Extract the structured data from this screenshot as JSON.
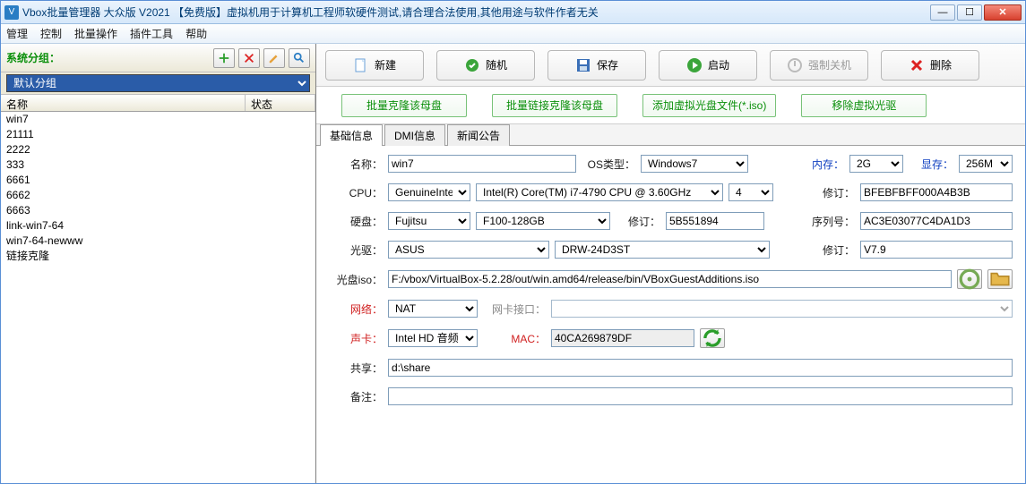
{
  "window": {
    "title": "Vbox批量管理器 大众版 V2021 【免费版】虚拟机用于计算机工程师软硬件测试,请合理合法使用,其他用途与软件作者无关"
  },
  "menu": [
    "管理",
    "控制",
    "批量操作",
    "插件工具",
    "帮助"
  ],
  "left": {
    "group_label": "系统分组：",
    "group_selected": "默认分组",
    "col_name": "名称",
    "col_status": "状态",
    "rows": [
      "win7",
      "21111",
      "2222",
      "333",
      "6661",
      "6662",
      "6663",
      "link-win7-64",
      "win7-64-newww",
      "链接克隆"
    ]
  },
  "toolbar1": {
    "new": "新建",
    "random": "随机",
    "save": "保存",
    "start": "启动",
    "force_off": "强制关机",
    "delete": "删除"
  },
  "toolbar2": {
    "clone": "批量克隆该母盘",
    "link_clone": "批量链接克隆该母盘",
    "add_iso": "添加虚拟光盘文件(*.iso)",
    "remove_iso": "移除虚拟光驱"
  },
  "tabs": [
    "基础信息",
    "DMI信息",
    "新闻公告"
  ],
  "form": {
    "name_lbl": "名称：",
    "name_val": "win7",
    "os_lbl": "OS类型：",
    "os_val": "Windows7",
    "mem_lbl": "内存：",
    "mem_val": "2G",
    "vram_lbl": "显存：",
    "vram_val": "256M",
    "cpu_lbl": "CPU：",
    "cpu_vendor": "GenuineIntel",
    "cpu_model": "Intel(R) Core(TM) i7-4790 CPU @ 3.60GHz",
    "cpu_count": "4",
    "cpu_rev_lbl": "修订：",
    "cpu_rev": "BFEBFBFF000A4B3B",
    "disk_lbl": "硬盘：",
    "disk_vendor": "Fujitsu",
    "disk_model": "F100-128GB",
    "disk_rev_lbl": "修订：",
    "disk_rev": "5B551894",
    "disk_sn_lbl": "序列号：",
    "disk_sn": "AC3E03077C4DA1D3",
    "optical_lbl": "光驱：",
    "optical_vendor": "ASUS",
    "optical_model": "DRW-24D3ST",
    "optical_rev_lbl": "修订：",
    "optical_rev": "V7.9",
    "iso_lbl": "光盘iso：",
    "iso_val": "F:/vbox/VirtualBox-5.2.28/out/win.amd64/release/bin/VBoxGuestAdditions.iso",
    "net_lbl": "网络：",
    "net_val": "NAT",
    "nic_lbl": "网卡接口：",
    "nic_val": "",
    "audio_lbl": "声卡：",
    "audio_val": "Intel HD 音频",
    "mac_lbl": "MAC：",
    "mac_val": "40CA269879DF",
    "share_lbl": "共享：",
    "share_val": "d:\\share",
    "note_lbl": "备注：",
    "note_val": ""
  }
}
